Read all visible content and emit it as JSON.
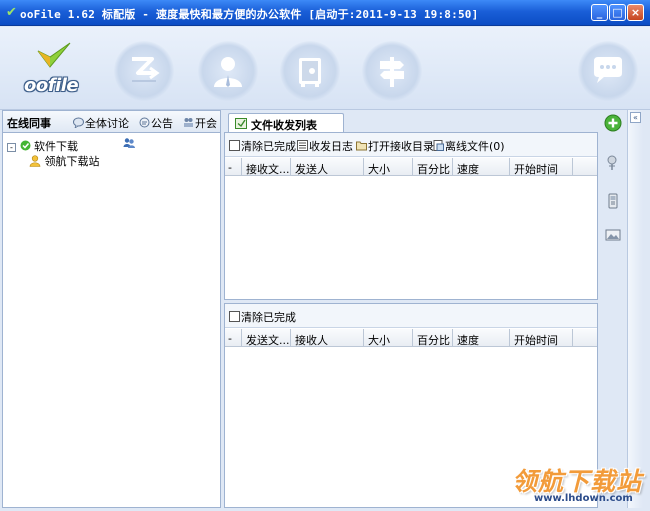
{
  "window": {
    "title": "ooFile 1.62 标配版 - 速度最快和最方便的办公软件 [启动于:2011-9-13 19:8:50]",
    "buttons": {
      "minimize": "_",
      "maximize": "□",
      "close": "×"
    }
  },
  "banner": {
    "logo_text": "oofile",
    "icons": [
      "send-file-icon",
      "user-icon",
      "safe-icon",
      "signpost-icon",
      "chat-bubble-icon"
    ]
  },
  "left_panel": {
    "tabs": [
      "在线同事",
      "全体讨论",
      "公告",
      "开会"
    ],
    "tree": {
      "group": {
        "expander": "-",
        "label": "软件下载"
      },
      "children": [
        {
          "label": "领航下载站"
        }
      ]
    }
  },
  "main": {
    "tab_label": "文件收发列表",
    "upper": {
      "toolbar": [
        "清除已完成",
        "收发日志",
        "打开接收目录",
        "离线文件(0)"
      ],
      "columns": [
        "-",
        "接收文...",
        "发送人",
        "大小",
        "百分比",
        "速度",
        "开始时间"
      ]
    },
    "lower": {
      "toolbar": [
        "清除已完成"
      ],
      "columns": [
        "-",
        "发送文...",
        "接收人",
        "大小",
        "百分比",
        "速度",
        "开始时间"
      ]
    }
  },
  "sidebar": {
    "collapse_label": "«",
    "icons": [
      "add-icon",
      "pin-icon",
      "phone-icon",
      "image-icon"
    ]
  },
  "watermark": {
    "text": "领航下载站",
    "url": "www.lhdown.com"
  },
  "colors": {
    "titlebar": "#1a5fd8",
    "panel_border": "#9fb3d1",
    "background": "#dfe8f5",
    "watermark": "#f29b3a"
  }
}
